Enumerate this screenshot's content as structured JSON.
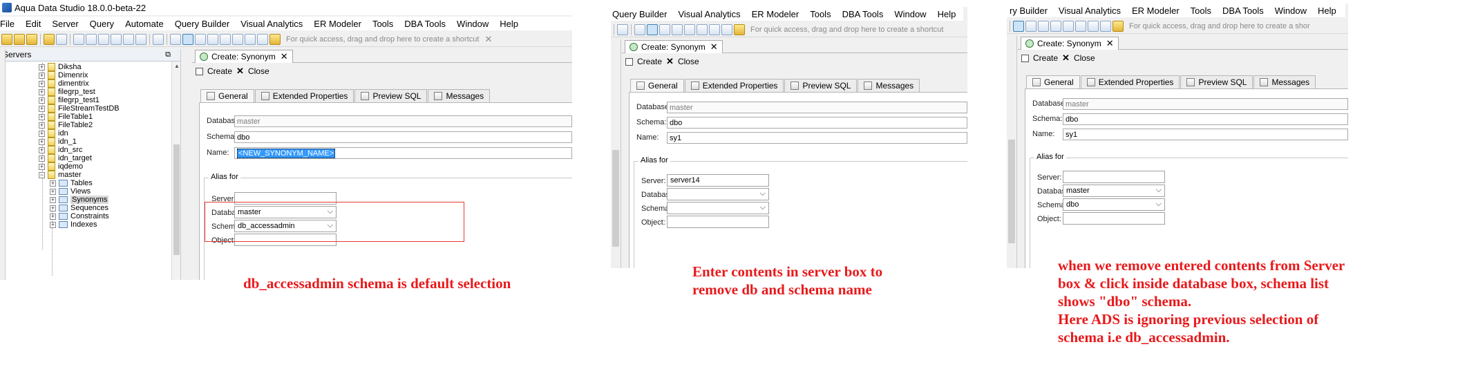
{
  "app": {
    "title": "Aqua Data Studio 18.0.0-beta-22"
  },
  "menu_items": [
    "File",
    "Edit",
    "Server",
    "Query",
    "Automate",
    "Query Builder",
    "Visual Analytics",
    "ER Modeler",
    "Tools",
    "DBA Tools",
    "Window",
    "Help"
  ],
  "menu_items_p2": [
    "Query Builder",
    "Visual Analytics",
    "ER Modeler",
    "Tools",
    "DBA Tools",
    "Window",
    "Help"
  ],
  "menu_items_p3": [
    "ry Builder",
    "Visual Analytics",
    "ER Modeler",
    "Tools",
    "DBA Tools",
    "Window",
    "Help"
  ],
  "toolbar": {
    "shortcut_text": "For quick access, drag and drop here to create a shortcut",
    "shortcut_text_p3": "For quick access, drag and drop here to create a shor"
  },
  "servers_panel": {
    "title": "Servers",
    "tree_items": [
      "Diksha",
      "Dimenrix",
      "dimentrix",
      "filegrp_test",
      "filegrp_test1",
      "FileStreamTestDB",
      "FileTable1",
      "FileTable2",
      "idn",
      "idn_1",
      "idn_src",
      "idn_target",
      "iqdemo",
      "master"
    ],
    "master_children": [
      "Tables",
      "Views",
      "Synonyms",
      "Sequences",
      "Constraints",
      "Indexes"
    ]
  },
  "editor": {
    "tab_title": "Create: Synonym",
    "create_label": "Create",
    "close_label": "Close",
    "subtabs": [
      "General",
      "Extended Properties",
      "Preview SQL",
      "Messages"
    ]
  },
  "labels": {
    "database": "Database:",
    "schema": "Schema:",
    "name": "Name:",
    "alias_for": "Alias for",
    "server": "Server:",
    "object": "Object:"
  },
  "screen1": {
    "database": "master",
    "schema": "dbo",
    "name": "<NEW_SYNONYM_NAME>",
    "alias": {
      "server": "",
      "database": "master",
      "schema": "db_accessadmin",
      "object": ""
    }
  },
  "screen2": {
    "database": "master",
    "schema": "dbo",
    "name": "sy1",
    "alias": {
      "server": "server14",
      "database": "",
      "schema": "",
      "object": ""
    }
  },
  "screen3": {
    "database": "master",
    "schema": "dbo",
    "name": "sy1",
    "alias": {
      "server": "",
      "database": "master",
      "schema": "dbo",
      "object": ""
    }
  },
  "annotations": {
    "a1": "db_accessadmin schema is default selection",
    "a2": [
      "Enter contents in server box to",
      "remove db and schema name"
    ],
    "a3": [
      "when we remove entered contents from Server",
      "box & click inside database box, schema list",
      "shows \"dbo\" schema.",
      "Here ADS is ignoring previous selection of",
      "schema i.e db_accessadmin."
    ]
  },
  "colors": {
    "annotation": "#e8191b",
    "selection": "#3399ff",
    "highlight_box": "#e53935"
  }
}
